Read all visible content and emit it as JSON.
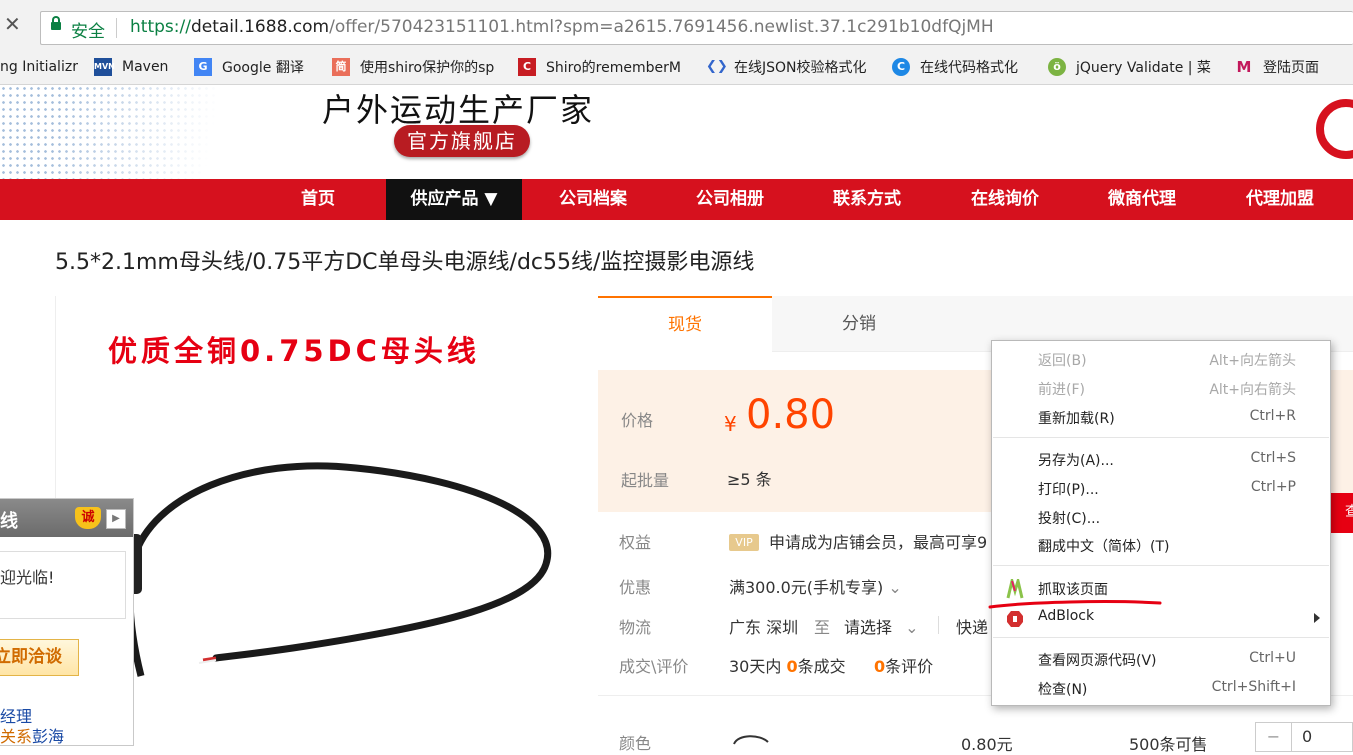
{
  "browser": {
    "secure_label": "安全",
    "url_scheme": "https://",
    "url_host": "detail.1688.com",
    "url_path": "/offer/570423151101.html?spm=a2615.7691456.newlist.37.1c291b10dfQjMH",
    "bookmarks": [
      {
        "label": "ng Initializr",
        "icon": "spring-icon",
        "color": "#6db33f"
      },
      {
        "label": "Maven",
        "icon": "maven-icon",
        "color": "#1f4f9a"
      },
      {
        "label": "Google 翻译",
        "icon": "google-translate-icon",
        "color": "#4285f4"
      },
      {
        "label": "使用shiro保护你的sp",
        "icon": "jianshu-icon",
        "color": "#ea6f5a"
      },
      {
        "label": "Shiro的rememberM",
        "icon": "csdn-icon",
        "color": "#c71d23"
      },
      {
        "label": "在线JSON校验格式化",
        "icon": "json-icon",
        "color": "#3366cc"
      },
      {
        "label": "在线代码格式化",
        "icon": "code-format-icon",
        "color": "#1e88e5"
      },
      {
        "label": "jQuery Validate | 菜",
        "icon": "runoob-icon",
        "color": "#7cb342"
      },
      {
        "label": "登陆页面",
        "icon": "login-page-icon",
        "color": "#c2185b"
      }
    ]
  },
  "shop": {
    "name": "户外运动生产厂家",
    "badge": "官方旗舰店",
    "nav": [
      "首页",
      "供应产品 ▼",
      "公司档案",
      "公司相册",
      "联系方式",
      "在线询价",
      "微商代理",
      "代理加盟"
    ]
  },
  "product": {
    "title": "5.5*2.1mm母头线/0.75平方DC单母头电源线/dc55线/监控摄影电源线",
    "image_caption": "优质全铜0.75DC母头线",
    "tabs": [
      "现货",
      "分销"
    ],
    "price_label": "价格",
    "currency": "¥",
    "price": "0.80",
    "moq_label": "起批量",
    "moq": "≥5 条",
    "rights_label": "权益",
    "vip": "VIP",
    "rights_text": "申请成为店铺会员，最高可享9",
    "promo_label": "优惠",
    "promo_text": "满300.0元(手机专享)",
    "logistics_label": "物流",
    "logistics_from": "广东 深圳",
    "logistics_to_word": "至",
    "logistics_select": "请选择",
    "logistics_method": "快递",
    "deal_label": "成交\\评价",
    "deal_prefix": "30天内",
    "deal_count": "0",
    "deal_suffix": "条成交",
    "review_count": "0",
    "review_suffix": "条评价",
    "red_button_fragment": "查",
    "color_label": "颜色",
    "sku_price": "0.80元",
    "sku_stock": "500条可售",
    "stepper_minus": "−",
    "quantity": "0"
  },
  "chat": {
    "title": "线",
    "badge": "诚",
    "collapse": "▶",
    "greeting": "欢迎光临!",
    "contact_button": "立即洽谈",
    "footer_line1": "经理",
    "footer_line2a": "关系",
    "footer_line2b": "彭海"
  },
  "context_menu": {
    "items": [
      {
        "label": "返回(B)",
        "shortcut": "Alt+向左箭头",
        "disabled": true
      },
      {
        "label": "前进(F)",
        "shortcut": "Alt+向右箭头",
        "disabled": true
      },
      {
        "label": "重新加载(R)",
        "shortcut": "Ctrl+R",
        "disabled": false
      },
      {
        "label": "另存为(A)...",
        "shortcut": "Ctrl+S",
        "disabled": false
      },
      {
        "label": "打印(P)...",
        "shortcut": "Ctrl+P",
        "disabled": false
      },
      {
        "label": "投射(C)...",
        "shortcut": "",
        "disabled": false
      },
      {
        "label": "翻成中文（简体）(T)",
        "shortcut": "",
        "disabled": false
      },
      {
        "label": "抓取该页面",
        "shortcut": "",
        "disabled": false
      },
      {
        "label": "AdBlock",
        "shortcut": "",
        "disabled": false
      },
      {
        "label": "查看网页源代码(V)",
        "shortcut": "Ctrl+U",
        "disabled": false
      },
      {
        "label": "检查(N)",
        "shortcut": "Ctrl+Shift+I",
        "disabled": false
      }
    ]
  },
  "colors": {
    "brand_red": "#d6111e",
    "price_orange": "#ff4400",
    "accent_orange": "#ff7300",
    "secure_green": "#0b8043",
    "annotation_red": "#e60012"
  }
}
